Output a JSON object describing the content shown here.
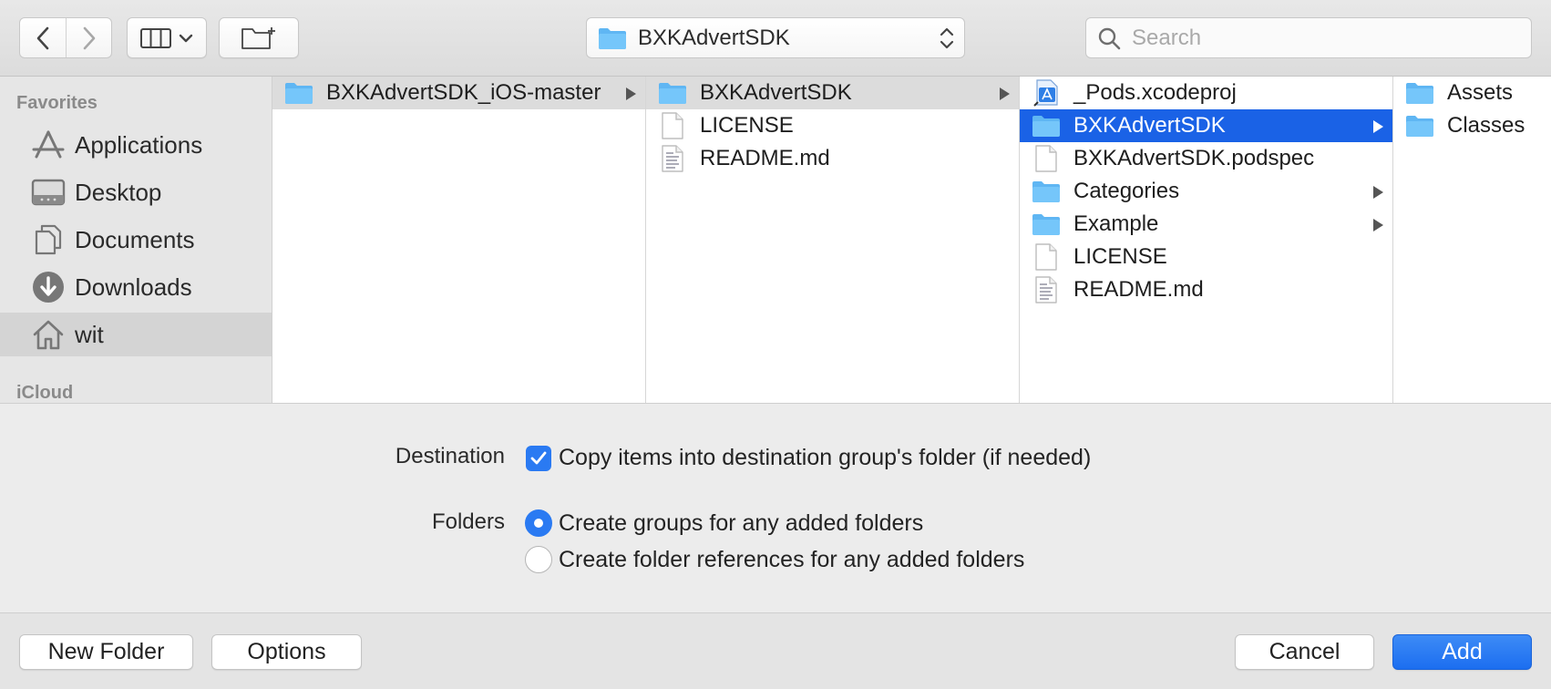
{
  "toolbar": {
    "path_popup": "BXKAdvertSDK",
    "search_placeholder": "Search"
  },
  "sidebar": {
    "favorites_header": "Favorites",
    "items": [
      {
        "label": "Applications",
        "icon": "applications-icon"
      },
      {
        "label": "Desktop",
        "icon": "desktop-icon"
      },
      {
        "label": "Documents",
        "icon": "documents-icon"
      },
      {
        "label": "Downloads",
        "icon": "downloads-icon"
      },
      {
        "label": "wit",
        "icon": "home-icon",
        "selected": true
      }
    ],
    "icloud_header": "iCloud"
  },
  "columns": [
    {
      "rows": [
        {
          "label": "BXKAdvertSDK_iOS-master",
          "icon": "folder-icon",
          "state": "path",
          "arrow": true
        }
      ]
    },
    {
      "rows": [
        {
          "label": "BXKAdvertSDK",
          "icon": "folder-icon",
          "state": "path",
          "arrow": true
        },
        {
          "label": "LICENSE",
          "icon": "document-icon"
        },
        {
          "label": "README.md",
          "icon": "text-document-icon"
        }
      ]
    },
    {
      "rows": [
        {
          "label": "_Pods.xcodeproj",
          "icon": "xcodeproj-icon"
        },
        {
          "label": "BXKAdvertSDK",
          "icon": "folder-icon",
          "state": "active",
          "arrow": true
        },
        {
          "label": "BXKAdvertSDK.podspec",
          "icon": "document-icon"
        },
        {
          "label": "Categories",
          "icon": "folder-icon",
          "arrow": true
        },
        {
          "label": "Example",
          "icon": "folder-icon",
          "arrow": true
        },
        {
          "label": "LICENSE",
          "icon": "document-icon"
        },
        {
          "label": "README.md",
          "icon": "text-document-icon"
        }
      ]
    },
    {
      "rows": [
        {
          "label": "Assets",
          "icon": "folder-icon"
        },
        {
          "label": "Classes",
          "icon": "folder-icon"
        }
      ]
    }
  ],
  "options": {
    "destination_label": "Destination",
    "copy_items_label": "Copy items into destination group's folder (if needed)",
    "copy_items_checked": true,
    "folders_label": "Folders",
    "create_groups_label": "Create groups for any added folders",
    "create_references_label": "Create folder references for any added folders",
    "folders_selected": "create_groups"
  },
  "buttons": {
    "new_folder": "New Folder",
    "options": "Options",
    "cancel": "Cancel",
    "add": "Add"
  },
  "colors": {
    "accent": "#1a62e6",
    "folder": "#5fb6f3",
    "window_bg": "#ececec"
  }
}
